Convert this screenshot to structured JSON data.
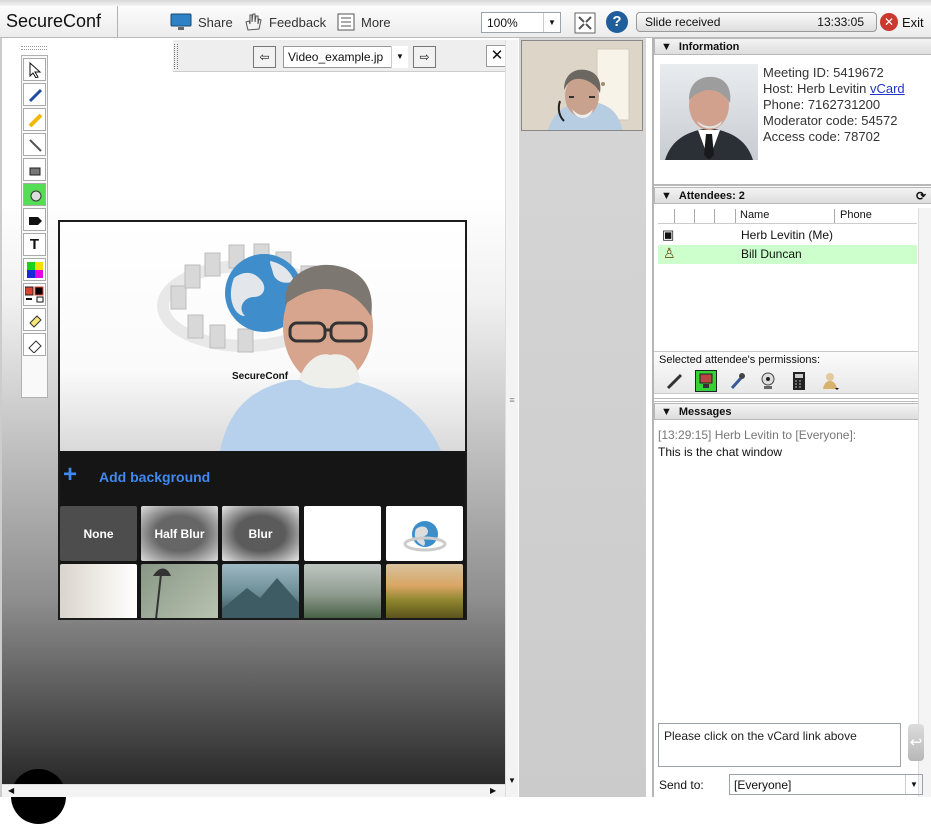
{
  "app": {
    "title": "SecureConf"
  },
  "toolbar": {
    "share": "Share",
    "feedback": "Feedback",
    "more": "More",
    "zoom": "100%",
    "status": "Slide received",
    "time": "13:33:05",
    "exit": "Exit"
  },
  "slide": {
    "filename": "Video_example.jp",
    "add_background": "Add background",
    "background_options": [
      {
        "label": "None"
      },
      {
        "label": "Half Blur"
      },
      {
        "label": "Blur"
      },
      {
        "label": ""
      },
      {
        "label": ""
      },
      {
        "label": ""
      },
      {
        "label": ""
      },
      {
        "label": ""
      },
      {
        "label": ""
      },
      {
        "label": ""
      }
    ],
    "logo_text": "SecureConf"
  },
  "info": {
    "title": "Information",
    "meeting_id": "Meeting ID: 5419672",
    "host": "Host: Herb Levitin",
    "vcard": "vCard",
    "phone": "Phone:  7162731200",
    "moderator": "Moderator code: 54572",
    "access": "Access code:  78702"
  },
  "attendees": {
    "title": "Attendees: 2",
    "headers": [
      "Name",
      "Phone"
    ],
    "rows": [
      {
        "name": "Herb Levitin (Me)"
      },
      {
        "name": "Bill Duncan"
      }
    ],
    "permissions_label": "Selected attendee's permissions:"
  },
  "messages": {
    "title": "Messages",
    "header": "[13:29:15] Herb Levitin to [Everyone]:",
    "text": "This is the chat window",
    "input": "Please click on the vCard link above",
    "send_to_label": "Send to:",
    "send_to": "[Everyone]"
  },
  "colors": {
    "accent": "#3f89f0",
    "selected_row": "#ccffcc"
  }
}
